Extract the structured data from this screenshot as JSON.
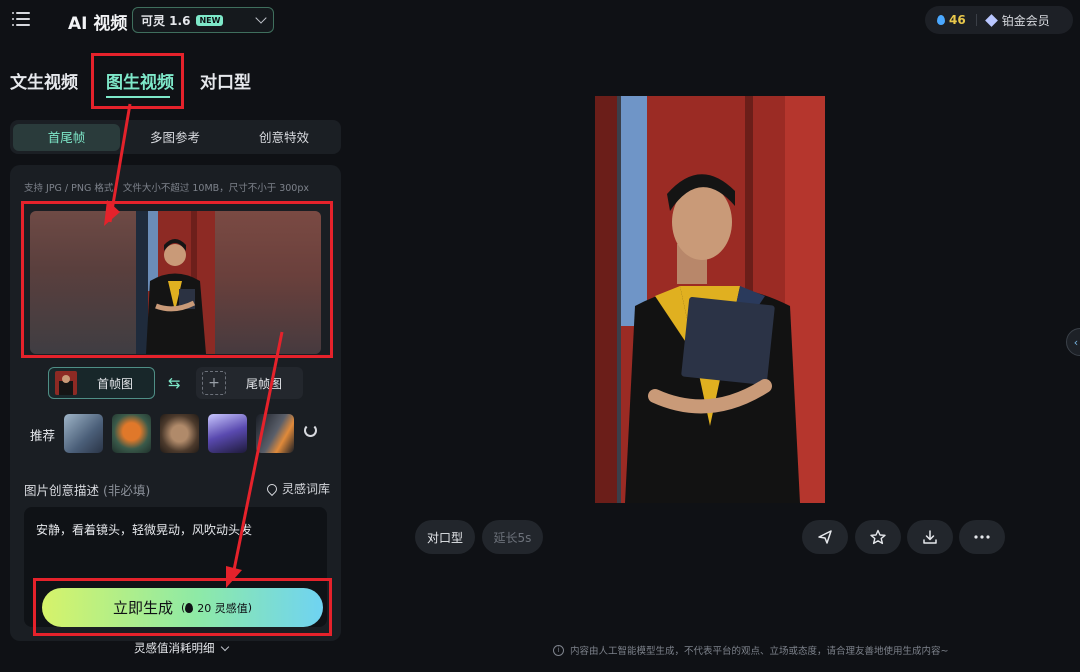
{
  "header": {
    "app_title": "AI 视频",
    "model": {
      "name": "可灵 1.6",
      "badge": "NEW"
    },
    "account": {
      "credits": "46",
      "membership": "铂金会员"
    }
  },
  "mode_tabs": [
    {
      "label": "文生视频",
      "active": false
    },
    {
      "label": "图生视频",
      "active": true
    },
    {
      "label": "对口型",
      "active": false
    }
  ],
  "sub_tabs": [
    {
      "label": "首尾帧",
      "active": true
    },
    {
      "label": "多图参考",
      "active": false
    },
    {
      "label": "创意特效",
      "active": false
    }
  ],
  "upload": {
    "hint": "支持 JPG / PNG 格式，文件大小不超过 10MB，尺寸不小于 300px",
    "first_frame_label": "首帧图",
    "last_frame_label": "尾帧图",
    "add_icon": "plus-icon"
  },
  "recommend": {
    "label": "推荐",
    "thumbnails": [
      "thumb-1",
      "thumb-2",
      "thumb-3",
      "thumb-4",
      "thumb-5"
    ]
  },
  "description": {
    "label": "图片创意描述",
    "optional": "(非必填)",
    "library_link": "灵感词库",
    "value": "安静，看着镜头，轻微晃动，风吹动头发"
  },
  "generate": {
    "label": "立即生成",
    "cost": "20 灵感值"
  },
  "cost_detail_link": "灵感值消耗明细",
  "preview_actions": {
    "lip_sync": "对口型",
    "extend": "延长5s",
    "icons": [
      "send-icon",
      "star-icon",
      "download-icon",
      "more-icon"
    ]
  },
  "disclaimer": "内容由人工智能模型生成，不代表平台的观点、立场或态度，请合理友善地使用生成内容~",
  "colors": {
    "accent": "#7ee8c9",
    "highlight": "#e5222b",
    "background": "#0f1115"
  }
}
